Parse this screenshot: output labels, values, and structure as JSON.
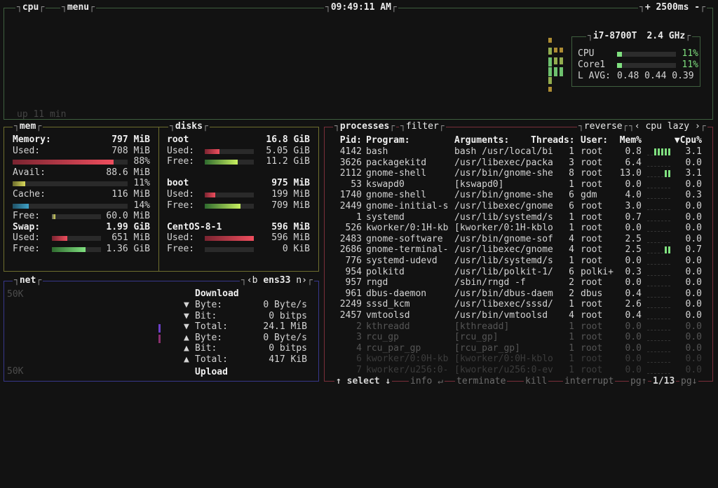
{
  "cpu_box": {
    "title": "cpu",
    "menu_label": "menu",
    "clock": "09:49:11 AM",
    "interval": "+ 2500ms -",
    "uptime": "up 11 min",
    "model": "i7-8700T",
    "freq": "2.4 GHz",
    "rows": [
      {
        "label": "CPU",
        "value": "11%",
        "fill": 0.11
      },
      {
        "label": "Core1",
        "value": "11%",
        "fill": 0.11
      }
    ],
    "lavg_label": "L AVG:",
    "lavg": "0.48 0.44 0.39"
  },
  "mem_box": {
    "title": "mem",
    "rows": [
      {
        "label": "Memory:",
        "value": "797 MiB",
        "bold": true
      },
      {
        "label": "Used:",
        "value": "708 MiB"
      },
      {
        "label": "",
        "value": "88%",
        "bar": "used",
        "fill": 0.88
      },
      {
        "label": "Avail:",
        "value": "88.6 MiB"
      },
      {
        "label": "",
        "value": "11%",
        "bar": "avail",
        "fill": 0.11
      },
      {
        "label": "Cache:",
        "value": "116 MiB"
      },
      {
        "label": "",
        "value": "14%",
        "bar": "cache",
        "fill": 0.14
      },
      {
        "label": "Free:",
        "value": "60.0 MiB",
        "bar": "free-inline",
        "fill": 0.07
      },
      {
        "label": "Swap:",
        "value": "1.99 GiB",
        "bold": true
      },
      {
        "label": "Used:",
        "value": "651 MiB",
        "bar": "swap-used",
        "fill": 0.32
      },
      {
        "label": "Free:",
        "value": "1.36 GiB",
        "bar": "swap-free",
        "fill": 0.68
      }
    ]
  },
  "disks_box": {
    "title": "disks",
    "disks": [
      {
        "name": "root",
        "total": "16.8 GiB",
        "used": "5.05 GiB",
        "free": "11.2 GiB",
        "used_fill": 0.3,
        "free_fill": 0.67
      },
      {
        "name": "boot",
        "total": "975 MiB",
        "used": "199 MiB",
        "free": "709 MiB",
        "used_fill": 0.21,
        "free_fill": 0.73
      },
      {
        "name": "CentOS-8-1",
        "total": "596 MiB",
        "used": "596 MiB",
        "free": "0 KiB",
        "used_fill": 1.0,
        "free_fill": 0.0
      }
    ],
    "used_label": "Used:",
    "free_label": "Free:"
  },
  "net_box": {
    "title": "net",
    "iface_prev": "‹b",
    "iface": "ens33",
    "iface_next": "n›",
    "scale_top": "50K",
    "scale_bottom": "50K",
    "download_label": "Download",
    "upload_label": "Upload",
    "stats": [
      {
        "arrow": "▼",
        "label": "Byte:",
        "value": "0 Byte/s"
      },
      {
        "arrow": "▼",
        "label": "Bit:",
        "value": "0 bitps"
      },
      {
        "arrow": "▼",
        "label": "Total:",
        "value": "24.1 MiB"
      },
      {
        "arrow": "▲",
        "label": "Byte:",
        "value": "0 Byte/s"
      },
      {
        "arrow": "▲",
        "label": "Bit:",
        "value": "0 bitps"
      },
      {
        "arrow": "▲",
        "label": "Total:",
        "value": "417 KiB"
      }
    ]
  },
  "proc_box": {
    "title": "processes",
    "filter_label": "filter",
    "reverse_label": "reverse",
    "sort_prev": "‹",
    "sort_label": "cpu lazy",
    "sort_next": "›",
    "headers": {
      "pid": "Pid:",
      "program": "Program:",
      "args": "Arguments:",
      "threads": "Threads:",
      "user": "User:",
      "mem": "Mem%",
      "cpu": "▼Cpu%"
    },
    "rows": [
      {
        "pid": "4142",
        "program": "bash",
        "args": "bash /usr/local/bi",
        "threads": "1",
        "user": "root",
        "mem": "0.8",
        "cpu": "3.1",
        "graph": [
          0,
          0,
          2,
          2,
          2,
          2,
          2
        ]
      },
      {
        "pid": "3626",
        "program": "packagekitd",
        "args": "/usr/libexec/packa",
        "threads": "3",
        "user": "root",
        "mem": "6.4",
        "cpu": "0.0",
        "graph": []
      },
      {
        "pid": "2112",
        "program": "gnome-shell",
        "args": "/usr/bin/gnome-she",
        "threads": "8",
        "user": "root",
        "mem": "13.0",
        "cpu": "3.1",
        "graph": [
          0,
          0,
          0,
          0,
          0,
          2,
          2
        ]
      },
      {
        "pid": "53",
        "program": "kswapd0",
        "args": "[kswapd0]",
        "threads": "1",
        "user": "root",
        "mem": "0.0",
        "cpu": "0.0",
        "graph": []
      },
      {
        "pid": "1740",
        "program": "gnome-shell",
        "args": "/usr/bin/gnome-she",
        "threads": "6",
        "user": "gdm",
        "mem": "4.0",
        "cpu": "0.3",
        "graph": []
      },
      {
        "pid": "2449",
        "program": "gnome-initial-s",
        "args": "/usr/libexec/gnome",
        "threads": "6",
        "user": "root",
        "mem": "3.0",
        "cpu": "0.0",
        "graph": []
      },
      {
        "pid": "1",
        "program": "systemd",
        "args": "/usr/lib/systemd/s",
        "threads": "1",
        "user": "root",
        "mem": "0.7",
        "cpu": "0.0",
        "graph": []
      },
      {
        "pid": "526",
        "program": "kworker/0:1H-kb",
        "args": "[kworker/0:1H-kblo",
        "threads": "1",
        "user": "root",
        "mem": "0.0",
        "cpu": "0.0",
        "graph": []
      },
      {
        "pid": "2483",
        "program": "gnome-software",
        "args": "/usr/bin/gnome-sof",
        "threads": "4",
        "user": "root",
        "mem": "2.5",
        "cpu": "0.0",
        "graph": []
      },
      {
        "pid": "2686",
        "program": "gnome-terminal-",
        "args": "/usr/libexec/gnome",
        "threads": "4",
        "user": "root",
        "mem": "2.5",
        "cpu": "0.7",
        "graph": [
          0,
          0,
          0,
          0,
          0,
          2,
          2
        ]
      },
      {
        "pid": "776",
        "program": "systemd-udevd",
        "args": "/usr/lib/systemd/s",
        "threads": "1",
        "user": "root",
        "mem": "0.0",
        "cpu": "0.0",
        "graph": []
      },
      {
        "pid": "954",
        "program": "polkitd",
        "args": "/usr/lib/polkit-1/",
        "threads": "6",
        "user": "polki+",
        "mem": "0.3",
        "cpu": "0.0",
        "graph": []
      },
      {
        "pid": "957",
        "program": "rngd",
        "args": "/sbin/rngd -f",
        "threads": "2",
        "user": "root",
        "mem": "0.0",
        "cpu": "0.0",
        "graph": []
      },
      {
        "pid": "961",
        "program": "dbus-daemon",
        "args": "/usr/bin/dbus-daem",
        "threads": "2",
        "user": "dbus",
        "mem": "0.4",
        "cpu": "0.0",
        "graph": []
      },
      {
        "pid": "2249",
        "program": "sssd_kcm",
        "args": "/usr/libexec/sssd/",
        "threads": "1",
        "user": "root",
        "mem": "2.6",
        "cpu": "0.0",
        "graph": []
      },
      {
        "pid": "2457",
        "program": "vmtoolsd",
        "args": "/usr/bin/vmtoolsd",
        "threads": "4",
        "user": "root",
        "mem": "0.4",
        "cpu": "0.0",
        "graph": []
      },
      {
        "pid": "2",
        "program": "kthreadd",
        "args": "[kthreadd]",
        "threads": "1",
        "user": "root",
        "mem": "0.0",
        "cpu": "0.0",
        "graph": []
      },
      {
        "pid": "3",
        "program": "rcu_gp",
        "args": "[rcu_gp]",
        "threads": "1",
        "user": "root",
        "mem": "0.0",
        "cpu": "0.0",
        "graph": []
      },
      {
        "pid": "4",
        "program": "rcu_par_gp",
        "args": "[rcu_par_gp]",
        "threads": "1",
        "user": "root",
        "mem": "0.0",
        "cpu": "0.0",
        "graph": []
      },
      {
        "pid": "6",
        "program": "kworker/0:0H-kb",
        "args": "[kworker/0:0H-kblo",
        "threads": "1",
        "user": "root",
        "mem": "0.0",
        "cpu": "0.0",
        "graph": []
      },
      {
        "pid": "7",
        "program": "kworker/u256:0-",
        "args": "[kworker/u256:0-ev",
        "threads": "1",
        "user": "root",
        "mem": "0.0",
        "cpu": "0.0",
        "graph": []
      }
    ],
    "footer": {
      "select": "↑ select ↓",
      "info": "info ↵",
      "terminate": "terminate",
      "kill": "kill",
      "interrupt": "interrupt",
      "pgup": "pg↑",
      "page": "1/13",
      "pgdn": "pg↓"
    }
  },
  "colors": {
    "cpu_border": "#3f5f3f",
    "mem_border": "#6e6e2e",
    "net_border": "#37378a",
    "proc_border": "#7a2f3a",
    "green": "#7fe07f",
    "red": "#ef4e5e",
    "yellow": "#d8d85a"
  }
}
